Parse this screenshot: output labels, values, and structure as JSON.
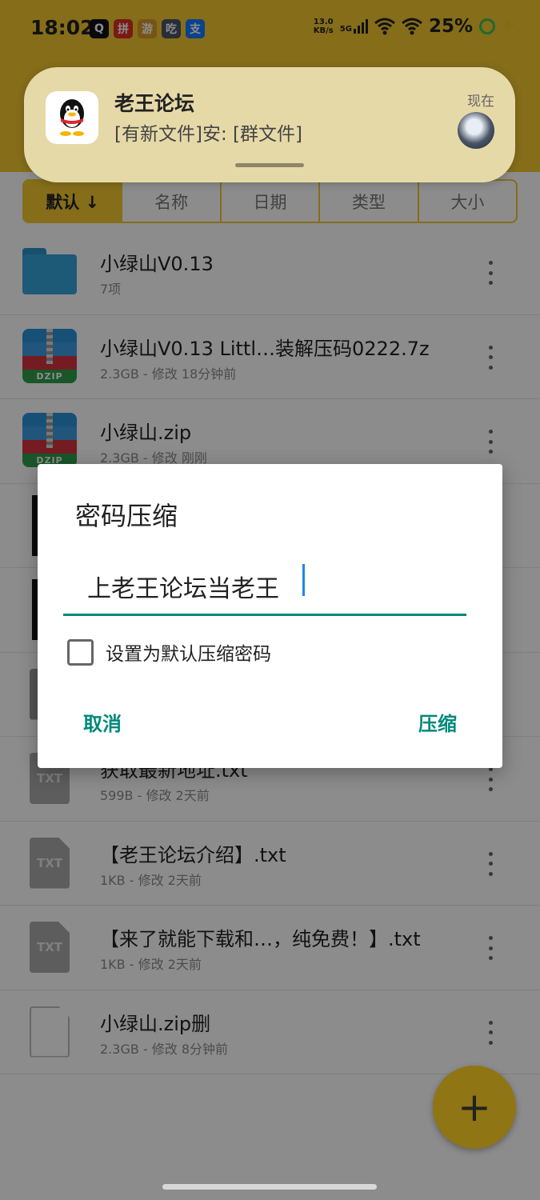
{
  "status_bar": {
    "time": "18:02",
    "apps": [
      {
        "icon": "qq-icon",
        "label": "Q",
        "color": "#111111"
      },
      {
        "icon": "pinduoduo-icon",
        "label": "拼",
        "color": "#e02e24"
      },
      {
        "icon": "game-icon",
        "label": "游",
        "color": "#d89a2b"
      },
      {
        "icon": "pubg-icon",
        "label": "吃",
        "color": "#4a5566"
      },
      {
        "icon": "alipay-icon",
        "label": "支",
        "color": "#1677ff"
      }
    ],
    "net_speed_value": "13.0",
    "net_speed_unit": "KB/s",
    "network": "5G",
    "battery": "25%"
  },
  "notification": {
    "app_icon": "qq-icon",
    "title": "老王论坛",
    "body": "[有新文件]安: [群文件]",
    "time": "现在"
  },
  "sort_tabs": [
    {
      "label": "默认 ↓",
      "active": true
    },
    {
      "label": "名称",
      "active": false
    },
    {
      "label": "日期",
      "active": false
    },
    {
      "label": "类型",
      "active": false
    },
    {
      "label": "大小",
      "active": false
    }
  ],
  "files": [
    {
      "type": "folder",
      "name": "小绿山V0.13",
      "meta": "7项"
    },
    {
      "type": "dzip",
      "name": "小绿山V0.13 Littl…装解压码0222.7z",
      "meta": "2.3GB - 修改 18分钟前"
    },
    {
      "type": "dzip",
      "name": "小绿山.zip",
      "meta": "2.3GB - 修改 刚刚"
    },
    {
      "type": "hidden",
      "name": "",
      "meta": ""
    },
    {
      "type": "hidden",
      "name": "",
      "meta": ""
    },
    {
      "type": "hidden",
      "name": "",
      "meta": ""
    },
    {
      "type": "txt",
      "name": "获取最新地址.txt",
      "meta": "599B - 修改 2天前"
    },
    {
      "type": "txt",
      "name": "【老王论坛介绍】.txt",
      "meta": "1KB - 修改 2天前"
    },
    {
      "type": "txt",
      "name": "【来了就能下载和…，纯免费！】.txt",
      "meta": "1KB - 修改 2天前"
    },
    {
      "type": "blank",
      "name": "小绿山.zip删",
      "meta": "2.3GB - 修改 8分钟前"
    }
  ],
  "dialog": {
    "title": "密码压缩",
    "password_value": "上老王论坛当老王",
    "checkbox_label": "设置为默认压缩密码",
    "checkbox_checked": false,
    "cancel_label": "取消",
    "confirm_label": "压缩"
  },
  "fab": {
    "label": "+"
  },
  "colors": {
    "accent_yellow": "#f3c631",
    "teal": "#00897b"
  }
}
